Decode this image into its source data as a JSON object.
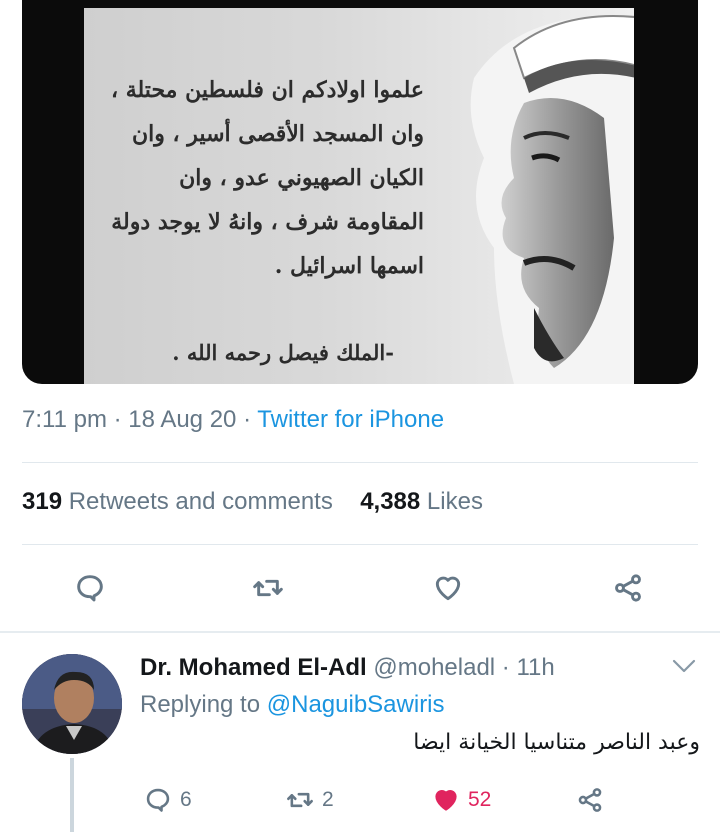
{
  "media": {
    "quote_lines": [
      "علموا اولادكم ان فلسطين محتلة ،",
      "وان المسجد الأقصى أسير ، وان",
      "الكيان الصهيوني عدو ، وان",
      "المقاومة شرف ، وانهُ لا يوجد دولة",
      "اسمها اسرائيل ."
    ],
    "signature": "-الملك فيصل رحمه الله ."
  },
  "tweet": {
    "time": "7:11 pm",
    "date": "18 Aug 20",
    "source": "Twitter for iPhone",
    "retweets_count": "319",
    "retweets_label": "Retweets and comments",
    "likes_count": "4,388",
    "likes_label": "Likes"
  },
  "reply": {
    "name": "Dr. Mohamed El-Adl",
    "handle": "@moheladl",
    "age": "11h",
    "replying_label": "Replying to",
    "replying_to": "@NaguibSawiris",
    "text": "وعبد الناصر متناسيا الخيانة ايضا",
    "comments": "6",
    "retweets": "2",
    "likes": "52"
  },
  "colors": {
    "link": "#1b95e0",
    "muted": "#657786",
    "like": "#e0245e"
  },
  "icons": [
    "comment-icon",
    "retweet-icon",
    "heart-icon",
    "share-icon",
    "chevron-down-icon"
  ]
}
